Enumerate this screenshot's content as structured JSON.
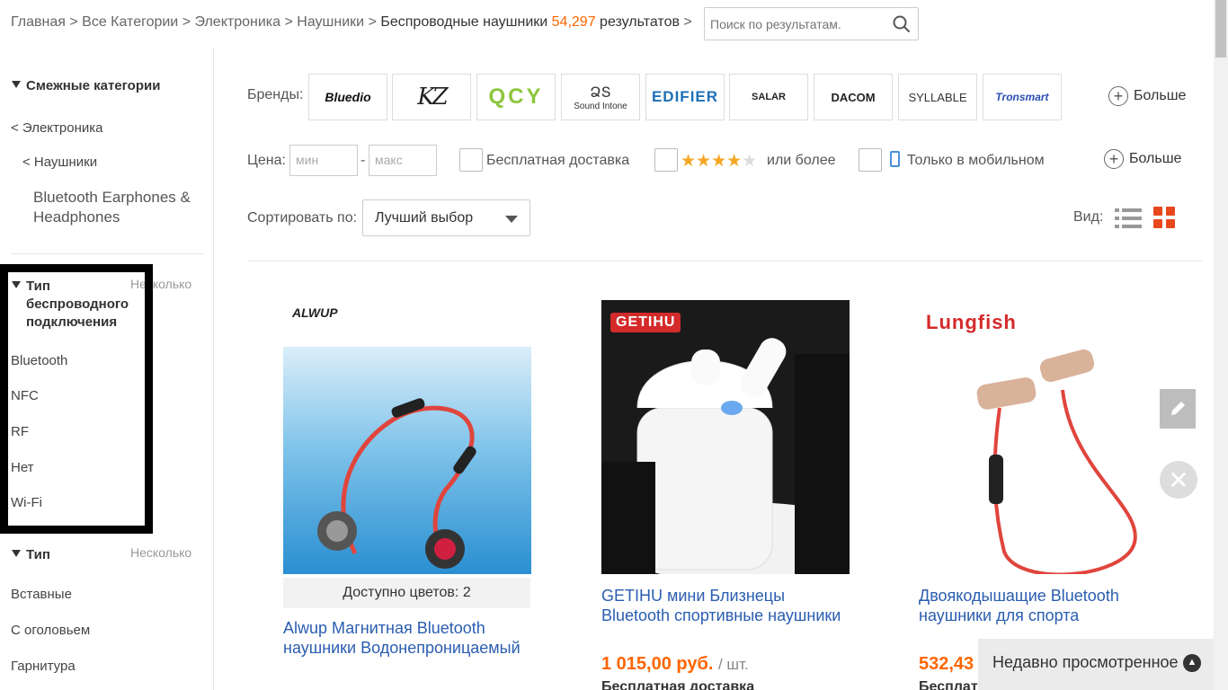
{
  "breadcrumb": {
    "items": [
      "Главная",
      "Все Категории",
      "Электроника",
      "Наушники"
    ],
    "separator": ">",
    "current": "Беспроводные наушники",
    "count": "54,297",
    "count_suffix": "результатов",
    "trailing": ">"
  },
  "search": {
    "placeholder": "Поиск по результатам."
  },
  "sidebar": {
    "related_title": "Смежные категории",
    "back_links": [
      "< Электроника",
      "< Наушники"
    ],
    "current_category": "Bluetooth Earphones & Headphones",
    "wireless_group": {
      "title": "Тип беспроводного подключения",
      "multi": "Несколько",
      "options": [
        "Bluetooth",
        "NFC",
        "RF",
        "Нет",
        "Wi-Fi"
      ]
    },
    "type_group": {
      "title": "Тип",
      "multi": "Несколько",
      "options": [
        "Вставные",
        "С оголовьем",
        "Гарнитура"
      ]
    }
  },
  "filters": {
    "brands_label": "Бренды:",
    "brands": [
      "Bluedio",
      "KZ",
      "QCY",
      "Sound Intone",
      "EDIFIER",
      "SALAR",
      "DACOM",
      "SYLLABLE",
      "Tronsmart"
    ],
    "more_label": "Больше",
    "price_label": "Цена:",
    "price_min_placeholder": "мин",
    "price_sep": "-",
    "price_max_placeholder": "макс",
    "free_shipping": "Бесплатная доставка",
    "rating_suffix": "или более",
    "rating_stars": 4,
    "mobile_only": "Только в мобильном",
    "more_label2": "Больше",
    "sort_label": "Сортировать по:",
    "sort_value": "Лучший выбор",
    "view_label": "Вид:"
  },
  "products": [
    {
      "brand": "ALWUP",
      "colors": "Доступно цветов: 2",
      "title": "Alwup Магнитная Bluetooth наушники Водонепроницаемый"
    },
    {
      "brand": "GETIHU",
      "title": "GETIHU мини Близнецы Bluetooth спортивные наушники",
      "price": "1 015,00 руб.",
      "unit": "/ шт.",
      "shipping": "Бесплатная доставка"
    },
    {
      "brand": "Lungfish",
      "title": "Двоякодышащие Bluetooth наушники для спорта",
      "price": "532,43",
      "shipping": "Бесплат"
    }
  ],
  "recent": {
    "label": "Недавно просмотренное"
  },
  "colors": {
    "accent": "#ff6600",
    "link": "#2a5db0",
    "grid_active": "#e8471c"
  }
}
